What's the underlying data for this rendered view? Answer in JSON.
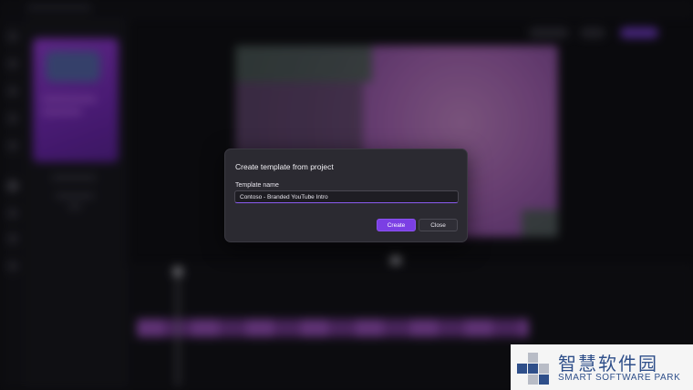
{
  "dialog": {
    "title": "Create template from project",
    "field_label": "Template name",
    "field_value": "Contoso - Branded YouTube Intro",
    "create_label": "Create",
    "close_label": "Close"
  },
  "watermark": {
    "cn": "智慧软件园",
    "en": "SMART SOFTWARE PARK"
  },
  "colors": {
    "accent": "#7b3fe4",
    "dialog_bg": "#2b2a31",
    "watermark_blue": "#2f4f8a"
  },
  "icons": [
    "smart-software-park-logo-icon"
  ]
}
